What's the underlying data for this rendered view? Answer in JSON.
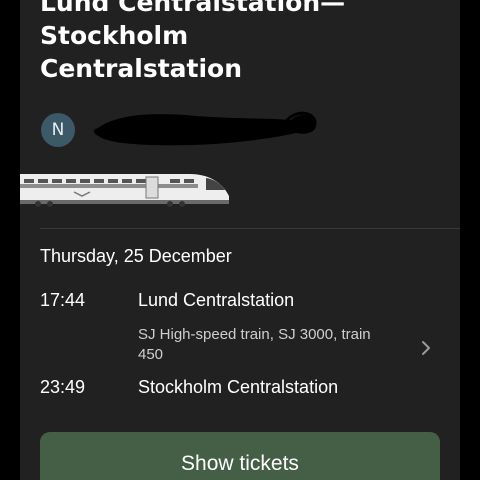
{
  "header": {
    "title_lines": [
      "Lund Centralstation—",
      "Stockholm",
      "Centralstation"
    ]
  },
  "passenger": {
    "avatar_initial": "N",
    "avatar_color": "#3c5967"
  },
  "trip": {
    "date": "Thursday, 25 December",
    "departure": {
      "time": "17:44",
      "station": "Lund Centralstation"
    },
    "train_details": "SJ High-speed train, SJ 3000, train 450",
    "arrival": {
      "time": "23:49",
      "station": "Stockholm Centralstation"
    }
  },
  "actions": {
    "show_tickets_label": "Show tickets",
    "button_color": "#455f46"
  },
  "icons": {
    "train": "train-illustration-icon",
    "chevron": "chevron-right-icon"
  }
}
